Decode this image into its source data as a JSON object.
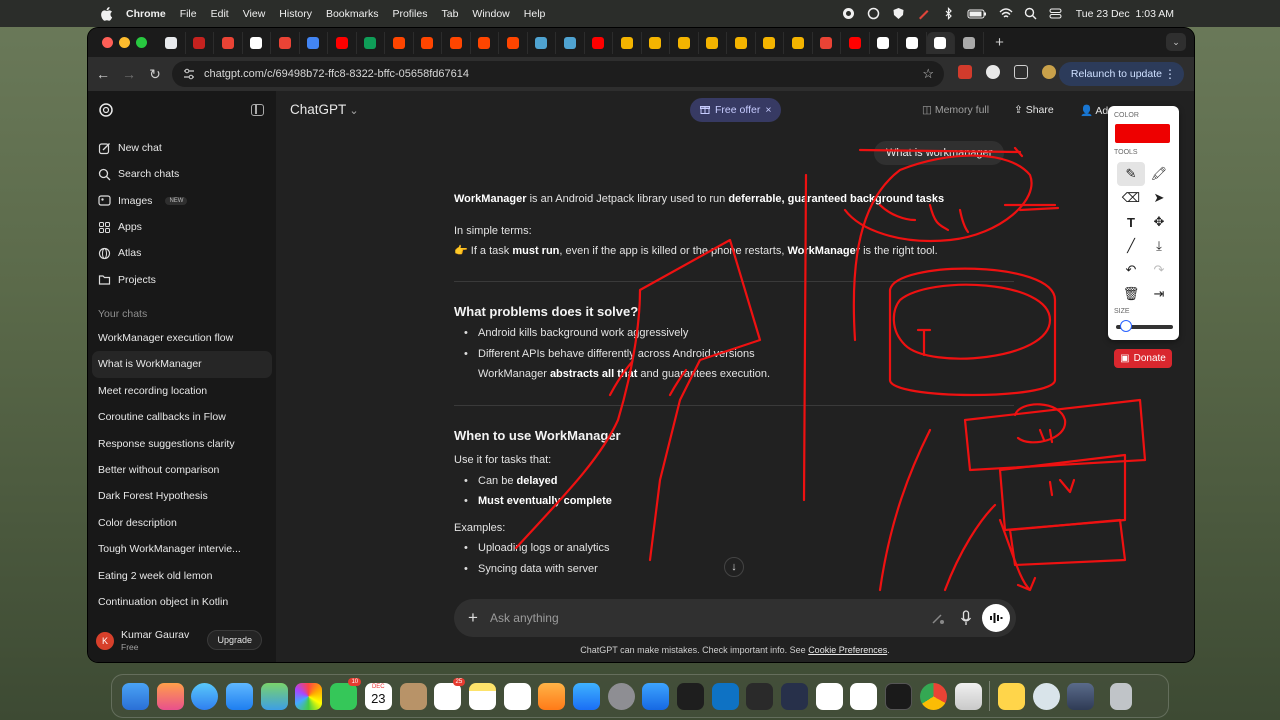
{
  "menubar": {
    "app_name": "Chrome",
    "menus": [
      "File",
      "Edit",
      "View",
      "History",
      "Bookmarks",
      "Profiles",
      "Tab",
      "Window",
      "Help"
    ],
    "clock": "Tue 23 Dec  1:03 AM"
  },
  "browser": {
    "url": "chatgpt.com/c/69498b72-ffc8-8322-bffc-05658fd67614",
    "relaunch_label": "Relaunch to update",
    "tab_colors": [
      "#e8eaed",
      "#c5221f",
      "#ea4335",
      "#ffffff",
      "#ea4335",
      "#4285f4",
      "#ff0000",
      "#0f9d58",
      "#ff4500",
      "#ff4500",
      "#ff4500",
      "#ff4500",
      "#ff4500",
      "#4fa3d1",
      "#4fa3d1",
      "#ff0000",
      "#f4b400",
      "#f4b400",
      "#f4b400",
      "#f4b400",
      "#f4b400",
      "#f4b400",
      "#f4b400",
      "#ea4335",
      "#ff0000",
      "#ffffff",
      "#ffffff",
      "#ffffff",
      "#aaaaaa"
    ]
  },
  "sidebar": {
    "nav": [
      {
        "label": "New chat",
        "icon": "new-chat-icon"
      },
      {
        "label": "Search chats",
        "icon": "search-icon"
      },
      {
        "label": "Images",
        "icon": "image-icon",
        "badge": "NEW"
      },
      {
        "label": "Apps",
        "icon": "apps-icon"
      },
      {
        "label": "Atlas",
        "icon": "globe-icon"
      },
      {
        "label": "Projects",
        "icon": "folder-icon"
      }
    ],
    "section_title": "Your chats",
    "chats": [
      "WorkManager execution flow",
      "What is WorkManager",
      "Meet recording location",
      "Coroutine callbacks in Flow",
      "Response suggestions clarity",
      "Better without comparison",
      "Dark Forest Hypothesis",
      "Color description",
      "Tough WorkManager intervie...",
      "Eating 2 week old lemon",
      "Continuation object in Kotlin"
    ],
    "active_chat_index": 1,
    "profile": {
      "initial": "K",
      "name": "Kumar Gaurav",
      "plan": "Free",
      "upgrade_label": "Upgrade"
    }
  },
  "header": {
    "model": "ChatGPT",
    "free_offer": "Free offer",
    "memory": "Memory full",
    "share": "Share",
    "add_people": "Ad"
  },
  "conversation": {
    "user_message": "What is workmanager",
    "intro_bold_1": "WorkManager",
    "intro_text_1": " is an Android Jetpack library used to run ",
    "intro_bold_2": "deferrable, guaranteed background tasks",
    "simple_terms": "In simple terms:",
    "tip_emoji": "👉",
    "tip_text_1": " If a task ",
    "tip_bold_1": "must run",
    "tip_text_2": ", even if the app is killed or the phone restarts, ",
    "tip_bold_2": "WorkManager",
    "tip_text_3": " is the right tool.",
    "section1_title": "What problems does it solve?",
    "section1_items": [
      "Android kills background work aggressively",
      "Different APIs behave differently across Android versions"
    ],
    "section1_tail_text_1": "WorkManager ",
    "section1_tail_bold": "abstracts all that",
    "section1_tail_text_2": " and guarantees execution.",
    "section2_title": "When to use WorkManager",
    "section2_intro": "Use it for tasks that:",
    "section2_item_1_text": "Can be ",
    "section2_item_1_bold": "delayed",
    "section2_item_2_bold": "Must eventually complete",
    "examples_label": "Examples:",
    "examples": [
      "Uploading logs or analytics",
      "Syncing data with server"
    ]
  },
  "composer": {
    "placeholder": "Ask anything",
    "disclaimer_text": "ChatGPT can make mistakes. Check important info. See ",
    "disclaimer_link": "Cookie Preferences",
    "disclaimer_end": "."
  },
  "draw_panel": {
    "color_label": "COLOR",
    "tools_label": "TOOLS",
    "size_label": "SIZE",
    "selected_color": "#ee0000",
    "size_level": 0.1,
    "donate_label": "Donate"
  },
  "dock": {
    "calendar_month": "DEC",
    "calendar_day": "23",
    "badge_facetime": "10",
    "badge_reminders": "25"
  }
}
